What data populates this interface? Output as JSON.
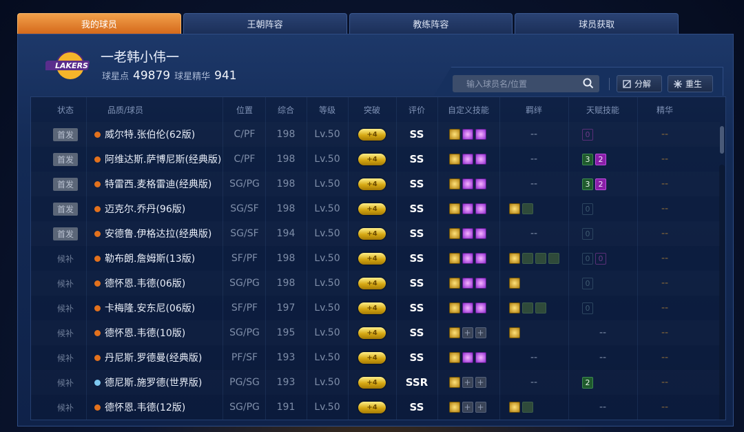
{
  "tabs": [
    "我的球员",
    "王朝阵容",
    "教练阵容",
    "球员获取"
  ],
  "profile": {
    "logo_text": "LAKERS",
    "name": "一老韩小伟一",
    "star_points_label": "球星点",
    "star_points": "49879",
    "essence_label": "球星精华",
    "essence": "941"
  },
  "search": {
    "placeholder": "输入球员名/位置"
  },
  "buttons": {
    "decompose": "分解",
    "rebirth": "重生"
  },
  "columns": [
    "状态",
    "品质/球员",
    "位置",
    "综合",
    "等级",
    "突破",
    "评价",
    "自定义技能",
    "羁绊",
    "天赋技能",
    "精华"
  ],
  "players": [
    {
      "status": "首发",
      "starter": true,
      "name": "威尔特.张伯伦(62版)",
      "quality": "orange",
      "pos": "C/PF",
      "ovr": "198",
      "level": "Lv.50",
      "breakthrough": "+4",
      "grade": "SS",
      "skills": [
        "g",
        "p",
        "p"
      ],
      "bonds": "--",
      "talent": [
        {
          "v": "0",
          "k": "emp p"
        }
      ],
      "essence": "--"
    },
    {
      "status": "首发",
      "starter": true,
      "name": "阿维达斯.萨博尼斯(经典版)",
      "quality": "orange",
      "pos": "C/PF",
      "ovr": "198",
      "level": "Lv.50",
      "breakthrough": "+4",
      "grade": "SS",
      "skills": [
        "g",
        "p",
        "p"
      ],
      "bonds": "--",
      "talent": [
        {
          "v": "3",
          "k": "g"
        },
        {
          "v": "2",
          "k": "p"
        }
      ],
      "essence": "--"
    },
    {
      "status": "首发",
      "starter": true,
      "name": "特雷西.麦格雷迪(经典版)",
      "quality": "orange",
      "pos": "SG/PG",
      "ovr": "198",
      "level": "Lv.50",
      "breakthrough": "+4",
      "grade": "SS",
      "skills": [
        "g",
        "p",
        "p"
      ],
      "bonds": "--",
      "talent": [
        {
          "v": "3",
          "k": "g"
        },
        {
          "v": "2",
          "k": "p"
        }
      ],
      "essence": "--"
    },
    {
      "status": "首发",
      "starter": true,
      "name": "迈克尔.乔丹(96版)",
      "quality": "orange",
      "pos": "SG/SF",
      "ovr": "198",
      "level": "Lv.50",
      "breakthrough": "+4",
      "grade": "SS",
      "skills": [
        "g",
        "p",
        "p"
      ],
      "bonds": "icons2",
      "talent": [
        {
          "v": "0",
          "k": "emp"
        }
      ],
      "essence": "--"
    },
    {
      "status": "首发",
      "starter": true,
      "name": "安德鲁.伊格达拉(经典版)",
      "quality": "orange",
      "pos": "SG/SF",
      "ovr": "194",
      "level": "Lv.50",
      "breakthrough": "+4",
      "grade": "SS",
      "skills": [
        "g",
        "p",
        "p"
      ],
      "bonds": "--",
      "talent": [
        {
          "v": "0",
          "k": "emp"
        }
      ],
      "essence": "--"
    },
    {
      "status": "候补",
      "starter": false,
      "name": "勒布朗.詹姆斯(13版)",
      "quality": "orange",
      "pos": "SF/PF",
      "ovr": "198",
      "level": "Lv.50",
      "breakthrough": "+4",
      "grade": "SS",
      "skills": [
        "g",
        "p",
        "p"
      ],
      "bonds": "icons4",
      "talent": [
        {
          "v": "0",
          "k": "emp"
        },
        {
          "v": "0",
          "k": "emp p"
        }
      ],
      "essence": "--"
    },
    {
      "status": "候补",
      "starter": false,
      "name": "德怀恩.韦德(06版)",
      "quality": "orange",
      "pos": "SG/PG",
      "ovr": "198",
      "level": "Lv.50",
      "breakthrough": "+4",
      "grade": "SS",
      "skills": [
        "g",
        "p",
        "p"
      ],
      "bonds": "icons1",
      "talent": [
        {
          "v": "0",
          "k": "emp"
        }
      ],
      "essence": "--"
    },
    {
      "status": "候补",
      "starter": false,
      "name": "卡梅隆.安东尼(06版)",
      "quality": "orange",
      "pos": "SF/PF",
      "ovr": "197",
      "level": "Lv.50",
      "breakthrough": "+4",
      "grade": "SS",
      "skills": [
        "g",
        "p",
        "p"
      ],
      "bonds": "icons3",
      "talent": [
        {
          "v": "0",
          "k": "emp"
        }
      ],
      "essence": "--"
    },
    {
      "status": "候补",
      "starter": false,
      "name": "德怀恩.韦德(10版)",
      "quality": "orange",
      "pos": "SG/PG",
      "ovr": "195",
      "level": "Lv.50",
      "breakthrough": "+4",
      "grade": "SS",
      "skills": [
        "g",
        "e",
        "e"
      ],
      "bonds": "icons1",
      "talent": "--",
      "essence": "--"
    },
    {
      "status": "候补",
      "starter": false,
      "name": "丹尼斯.罗德曼(经典版)",
      "quality": "orange",
      "pos": "PF/SF",
      "ovr": "193",
      "level": "Lv.50",
      "breakthrough": "+4",
      "grade": "SS",
      "skills": [
        "g",
        "p",
        "p"
      ],
      "bonds": "--",
      "talent": "--",
      "essence": "--"
    },
    {
      "status": "候补",
      "starter": false,
      "name": "德尼斯.施罗德(世界版)",
      "quality": "blue",
      "pos": "PG/SG",
      "ovr": "193",
      "level": "Lv.50",
      "breakthrough": "+4",
      "grade": "SSR",
      "skills": [
        "g",
        "e",
        "e"
      ],
      "bonds": "--",
      "talent": [
        {
          "v": "2",
          "k": "g"
        }
      ],
      "essence": "--"
    },
    {
      "status": "候补",
      "starter": false,
      "name": "德怀恩.韦德(12版)",
      "quality": "orange",
      "pos": "SG/PG",
      "ovr": "191",
      "level": "Lv.50",
      "breakthrough": "+4",
      "grade": "SS",
      "skills": [
        "g",
        "e",
        "e"
      ],
      "bonds": "icons2",
      "talent": "--",
      "essence": "--"
    }
  ]
}
